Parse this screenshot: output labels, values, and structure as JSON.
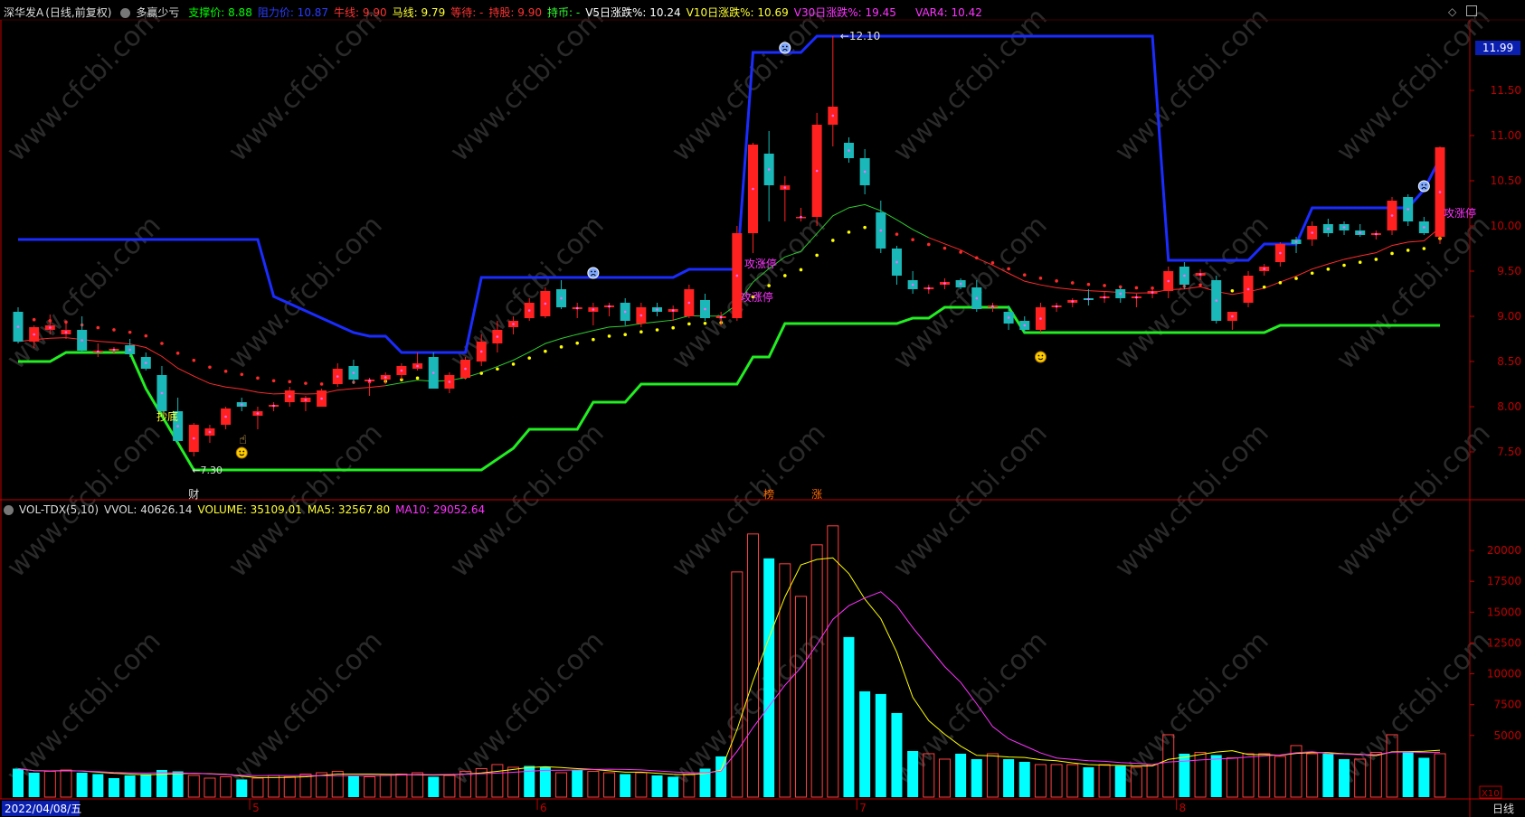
{
  "header": {
    "stock": "深华发A",
    "period": "(日线,前复权)",
    "indicator": "多赢少亏",
    "items": [
      {
        "label": "支撑价: ",
        "value": "8.88",
        "color": "#00ff00"
      },
      {
        "label": "阻力价: ",
        "value": "10.87",
        "color": "#2a3cff"
      },
      {
        "label": "牛线: ",
        "value": "9.90",
        "color": "#ff3333"
      },
      {
        "label": "马线: ",
        "value": "9.79",
        "color": "#ffff33"
      },
      {
        "label": "等待: ",
        "value": "-",
        "color": "#ff3333"
      },
      {
        "label": "持股: ",
        "value": "9.90",
        "color": "#ff3333"
      },
      {
        "label": "持币: ",
        "value": "-",
        "color": "#33ff33"
      },
      {
        "label": "V5日涨跌%: ",
        "value": "10.24",
        "color": "#ffffff"
      },
      {
        "label": "V10日涨跌%: ",
        "value": "10.69",
        "color": "#ffff33"
      },
      {
        "label": "V30日涨跌%: ",
        "value": "19.45",
        "color": "#ff33ff"
      }
    ],
    "var4": {
      "label": "VAR4: ",
      "value": "10.42",
      "color": "#ff33ff"
    }
  },
  "vol_header": {
    "name": "VOL-TDX(5,10)",
    "vvol": "VVOL: 40626.14",
    "volume": "VOLUME: 35109.01",
    "ma5": "MA5: 32567.80",
    "ma10": "MA10: 29052.64"
  },
  "last_price": "11.99",
  "footer": {
    "date": "2022/04/08/五",
    "period": "日线",
    "x10": "X10"
  },
  "annotations": {
    "high_label": "12.10",
    "low_label": "7.30",
    "chaodi": "抄底",
    "gzt": "攻涨停",
    "cai": "财",
    "bang": "榜",
    "zhang": "涨"
  },
  "colors": {
    "up": "#ff2020",
    "down": "#1ab8b8",
    "resistance": "#1a2cff",
    "support": "#22ee22",
    "ma_red": "#ff2a2a",
    "ma_green": "#2ecc2e",
    "dots_red": "#ff2a2a",
    "dots_yellow": "#ffff00",
    "vol_up": "#ff4040",
    "vol_down": "#00ffff",
    "vol_ma5": "#ffff00",
    "vol_ma10": "#ff33ff",
    "axis": "#c00000",
    "watermark": "#2a2a2a"
  },
  "chart_data": {
    "type": "candlestick",
    "price_axis": {
      "ticks": [
        "7.50",
        "8.00",
        "8.50",
        "9.00",
        "9.50",
        "10.00",
        "10.50",
        "11.00",
        "11.50"
      ],
      "range": [
        7.05,
        12.2
      ]
    },
    "volume_axis": {
      "ticks": [
        "5000",
        "7500",
        "10000",
        "12500",
        "15000",
        "17500",
        "20000"
      ],
      "range": [
        0,
        22500
      ]
    },
    "month_labels": [
      "5",
      "6",
      "7",
      "8"
    ],
    "month_index": [
      15,
      33,
      53,
      73
    ],
    "candles": [
      [
        9.05,
        9.1,
        8.7,
        8.72,
        0
      ],
      [
        8.72,
        8.9,
        8.65,
        8.88,
        1
      ],
      [
        8.9,
        9.02,
        8.8,
        8.85,
        1
      ],
      [
        8.85,
        8.92,
        8.75,
        8.8,
        1
      ],
      [
        8.85,
        9.0,
        8.6,
        8.62,
        0
      ],
      [
        8.62,
        8.7,
        8.55,
        8.6,
        1
      ],
      [
        8.62,
        8.66,
        8.58,
        8.64,
        1
      ],
      [
        8.68,
        8.75,
        8.55,
        8.58,
        0
      ],
      [
        8.55,
        8.6,
        8.4,
        8.42,
        0
      ],
      [
        8.35,
        8.45,
        7.9,
        7.95,
        0
      ],
      [
        7.95,
        8.1,
        7.6,
        7.62,
        0
      ],
      [
        7.5,
        7.82,
        7.45,
        7.8,
        1
      ],
      [
        7.68,
        7.8,
        7.6,
        7.76,
        1
      ],
      [
        7.8,
        8.0,
        7.75,
        7.98,
        1
      ],
      [
        8.0,
        8.1,
        7.95,
        8.05,
        0
      ],
      [
        7.9,
        8.0,
        7.75,
        7.95,
        1
      ],
      [
        8.0,
        8.05,
        7.95,
        8.02,
        1
      ],
      [
        8.05,
        8.22,
        8.0,
        8.18,
        1
      ],
      [
        8.05,
        8.12,
        7.95,
        8.1,
        1
      ],
      [
        8.0,
        8.2,
        8.0,
        8.18,
        1
      ],
      [
        8.25,
        8.48,
        8.22,
        8.42,
        1
      ],
      [
        8.45,
        8.52,
        8.25,
        8.3,
        0
      ],
      [
        8.28,
        8.32,
        8.12,
        8.3,
        1
      ],
      [
        8.3,
        8.38,
        8.25,
        8.35,
        1
      ],
      [
        8.35,
        8.48,
        8.3,
        8.45,
        1
      ],
      [
        8.42,
        8.6,
        8.4,
        8.48,
        1
      ],
      [
        8.55,
        8.6,
        8.25,
        8.2,
        0
      ],
      [
        8.2,
        8.38,
        8.15,
        8.35,
        1
      ],
      [
        8.32,
        8.55,
        8.3,
        8.52,
        1
      ],
      [
        8.5,
        8.8,
        8.45,
        8.72,
        1
      ],
      [
        8.7,
        8.95,
        8.6,
        8.85,
        1
      ],
      [
        8.88,
        9.0,
        8.8,
        8.95,
        1
      ],
      [
        8.98,
        9.2,
        8.95,
        9.15,
        1
      ],
      [
        9.0,
        9.32,
        8.98,
        9.28,
        1
      ],
      [
        9.3,
        9.4,
        9.08,
        9.1,
        0
      ],
      [
        9.1,
        9.15,
        8.98,
        9.08,
        1
      ],
      [
        9.05,
        9.15,
        8.9,
        9.1,
        1
      ],
      [
        9.1,
        9.15,
        9.0,
        9.12,
        1
      ],
      [
        9.15,
        9.2,
        8.9,
        8.95,
        0
      ],
      [
        8.92,
        9.15,
        8.88,
        9.1,
        1
      ],
      [
        9.1,
        9.15,
        9.0,
        9.05,
        0
      ],
      [
        9.05,
        9.12,
        8.95,
        9.08,
        1
      ],
      [
        9.0,
        9.35,
        8.98,
        9.3,
        1
      ],
      [
        9.18,
        9.25,
        8.95,
        8.98,
        0
      ],
      [
        8.98,
        9.05,
        8.9,
        9.0,
        1
      ],
      [
        8.98,
        10.0,
        8.95,
        9.92,
        1
      ],
      [
        9.92,
        10.92,
        9.7,
        10.9,
        1
      ],
      [
        10.8,
        11.05,
        10.05,
        10.45,
        0
      ],
      [
        10.4,
        10.55,
        10.05,
        10.45,
        1
      ],
      [
        10.1,
        10.2,
        10.05,
        10.1,
        1
      ],
      [
        10.1,
        11.25,
        10.0,
        11.12,
        1
      ],
      [
        11.12,
        12.1,
        10.88,
        11.32,
        1
      ],
      [
        10.92,
        10.98,
        10.7,
        10.75,
        0
      ],
      [
        10.75,
        10.85,
        10.35,
        10.45,
        0
      ],
      [
        10.15,
        10.28,
        9.7,
        9.75,
        0
      ],
      [
        9.75,
        9.78,
        9.35,
        9.45,
        0
      ],
      [
        9.4,
        9.5,
        9.25,
        9.3,
        0
      ],
      [
        9.3,
        9.35,
        9.25,
        9.32,
        1
      ],
      [
        9.35,
        9.42,
        9.3,
        9.38,
        1
      ],
      [
        9.4,
        9.42,
        9.3,
        9.32,
        0
      ],
      [
        9.32,
        9.4,
        9.05,
        9.08,
        0
      ],
      [
        9.12,
        9.15,
        9.05,
        9.1,
        1
      ],
      [
        9.05,
        9.12,
        8.85,
        8.92,
        0
      ],
      [
        8.95,
        9.0,
        8.82,
        8.85,
        0
      ],
      [
        8.85,
        9.15,
        8.82,
        9.1,
        1
      ],
      [
        9.1,
        9.15,
        9.05,
        9.12,
        1
      ],
      [
        9.15,
        9.2,
        9.1,
        9.18,
        1
      ],
      [
        9.18,
        9.3,
        9.12,
        9.2,
        0
      ],
      [
        9.2,
        9.28,
        9.15,
        9.22,
        1
      ],
      [
        9.3,
        9.32,
        9.15,
        9.2,
        0
      ],
      [
        9.2,
        9.25,
        9.1,
        9.22,
        1
      ],
      [
        9.25,
        9.32,
        9.2,
        9.28,
        1
      ],
      [
        9.28,
        9.55,
        9.2,
        9.5,
        1
      ],
      [
        9.55,
        9.6,
        9.3,
        9.35,
        0
      ],
      [
        9.45,
        9.52,
        9.4,
        9.48,
        1
      ],
      [
        9.4,
        9.45,
        8.92,
        8.95,
        0
      ],
      [
        8.95,
        9.05,
        8.85,
        9.05,
        1
      ],
      [
        9.15,
        9.5,
        9.1,
        9.45,
        1
      ],
      [
        9.5,
        9.58,
        9.45,
        9.55,
        1
      ],
      [
        9.6,
        9.82,
        9.55,
        9.8,
        1
      ],
      [
        9.8,
        9.88,
        9.7,
        9.85,
        0
      ],
      [
        9.85,
        10.05,
        9.78,
        10.0,
        1
      ],
      [
        10.02,
        10.08,
        9.88,
        9.92,
        0
      ],
      [
        10.02,
        10.05,
        9.9,
        9.95,
        0
      ],
      [
        9.95,
        10.02,
        9.88,
        9.9,
        0
      ],
      [
        9.9,
        9.95,
        9.85,
        9.92,
        1
      ],
      [
        9.95,
        10.32,
        9.9,
        10.28,
        1
      ],
      [
        10.32,
        10.35,
        10.0,
        10.05,
        0
      ],
      [
        10.05,
        10.1,
        9.9,
        9.92,
        0
      ],
      [
        9.88,
        10.88,
        9.8,
        10.87,
        1
      ]
    ],
    "volume_pct": [
      [
        10.5,
        0
      ],
      [
        9,
        0
      ],
      [
        9.5,
        1
      ],
      [
        10,
        1
      ],
      [
        9,
        0
      ],
      [
        8.5,
        0
      ],
      [
        7,
        0
      ],
      [
        8,
        0
      ],
      [
        8.5,
        0
      ],
      [
        10,
        0
      ],
      [
        9.5,
        0
      ],
      [
        8,
        1
      ],
      [
        7,
        1
      ],
      [
        7.5,
        1
      ],
      [
        6.5,
        0
      ],
      [
        7,
        1
      ],
      [
        8,
        1
      ],
      [
        7.5,
        1
      ],
      [
        8.5,
        1
      ],
      [
        9,
        1
      ],
      [
        9.5,
        1
      ],
      [
        8,
        0
      ],
      [
        7.5,
        1
      ],
      [
        8,
        1
      ],
      [
        8.5,
        1
      ],
      [
        9,
        1
      ],
      [
        7.5,
        0
      ],
      [
        8,
        1
      ],
      [
        9.5,
        1
      ],
      [
        10.5,
        1
      ],
      [
        12,
        1
      ],
      [
        11,
        1
      ],
      [
        11.5,
        0
      ],
      [
        11,
        0
      ],
      [
        9,
        1
      ],
      [
        10,
        0
      ],
      [
        9.5,
        1
      ],
      [
        9,
        1
      ],
      [
        8.5,
        0
      ],
      [
        9,
        1
      ],
      [
        8,
        0
      ],
      [
        7.5,
        0
      ],
      [
        8.5,
        1
      ],
      [
        10.5,
        0
      ],
      [
        15,
        0
      ],
      [
        83,
        1
      ],
      [
        97,
        1
      ],
      [
        88,
        0
      ],
      [
        86,
        1
      ],
      [
        74,
        1
      ],
      [
        93,
        1
      ],
      [
        100,
        1
      ],
      [
        59,
        0
      ],
      [
        39,
        0
      ],
      [
        38,
        0
      ],
      [
        31,
        0
      ],
      [
        17,
        0
      ],
      [
        16,
        1
      ],
      [
        14,
        1
      ],
      [
        16,
        0
      ],
      [
        14,
        0
      ],
      [
        16,
        1
      ],
      [
        14,
        0
      ],
      [
        13,
        0
      ],
      [
        12,
        1
      ],
      [
        12,
        1
      ],
      [
        12,
        1
      ],
      [
        11,
        0
      ],
      [
        12,
        1
      ],
      [
        11.5,
        0
      ],
      [
        11,
        1
      ],
      [
        12,
        1
      ],
      [
        23,
        1
      ],
      [
        16,
        0
      ],
      [
        16.5,
        1
      ],
      [
        15.5,
        0
      ],
      [
        14.5,
        1
      ],
      [
        16,
        1
      ],
      [
        16,
        1
      ],
      [
        15,
        1
      ],
      [
        19,
        1
      ],
      [
        16,
        1
      ],
      [
        16,
        0
      ],
      [
        14,
        0
      ],
      [
        14,
        1
      ],
      [
        16.5,
        1
      ],
      [
        23,
        1
      ],
      [
        16.5,
        0
      ],
      [
        14.5,
        0
      ],
      [
        16,
        1
      ]
    ]
  }
}
